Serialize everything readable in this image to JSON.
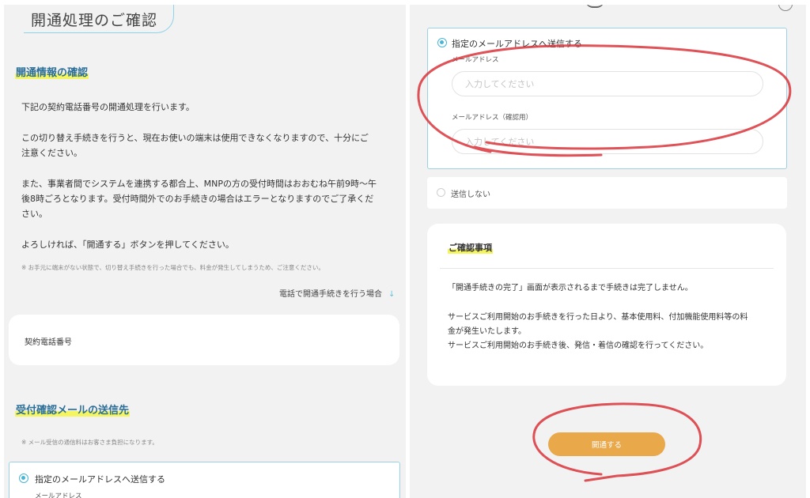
{
  "left": {
    "title": "開通処理のご確認",
    "section1_heading": "開通情報の確認",
    "paragraphs": [
      "下記の契約電話番号の開通処理を行います。",
      "この切り替え手続きを行うと、現在お使いの端末は使用できなくなりますので、十分にご",
      "注意ください。",
      "また、事業者間でシステムを連携する都合上、MNPの方の受付時間はおおむね午前9時〜午",
      "後8時ごろとなります。受付時間外でのお手続きの場合はエラーとなりますのでご了承くだ",
      "さい。",
      "よろしければ、「開通する」ボタンを押してください。"
    ],
    "note1": "※ お手元に端末がない状態で、切り替え手続きを行った場合でも、料金が発生してしまうため、ご注意ください。",
    "phone_link": "電話で開通手続きを行う場合",
    "phone_link_arrow": "↓",
    "contract_label": "契約電話番号",
    "section2_heading": "受付確認メールの送信先",
    "note2": "※ メール受信の通信料はお客さま負担になります。",
    "radio_send_label": "指定のメールアドレスへ送信する",
    "email_label": "メールアドレス"
  },
  "right": {
    "radio_send_label": "指定のメールアドレスへ送信する",
    "email_label": "メールアドレス",
    "email_placeholder": "入力してください",
    "email_confirm_label": "メールアドレス（確認用）",
    "email_confirm_placeholder": "入力してください",
    "radio_nosend_label": "送信しない",
    "confirm_heading": "ご確認事項",
    "confirm_lines": [
      "「開通手続きの完了」画面が表示されるまで手続きは完了しません。",
      "サービスご利用開始のお手続きを行った日より、基本使用料、付加機能使用料等の料",
      "金が発生いたします。",
      "サービスご利用開始のお手続き後、発信・着信の確認を行ってください。"
    ],
    "submit_label": "開通する"
  },
  "colors": {
    "accent": "#49b5d6",
    "heading": "#2b6f98",
    "highlight": "#f5f562",
    "cta": "#e9a84a",
    "annotation": "#d9343a"
  }
}
